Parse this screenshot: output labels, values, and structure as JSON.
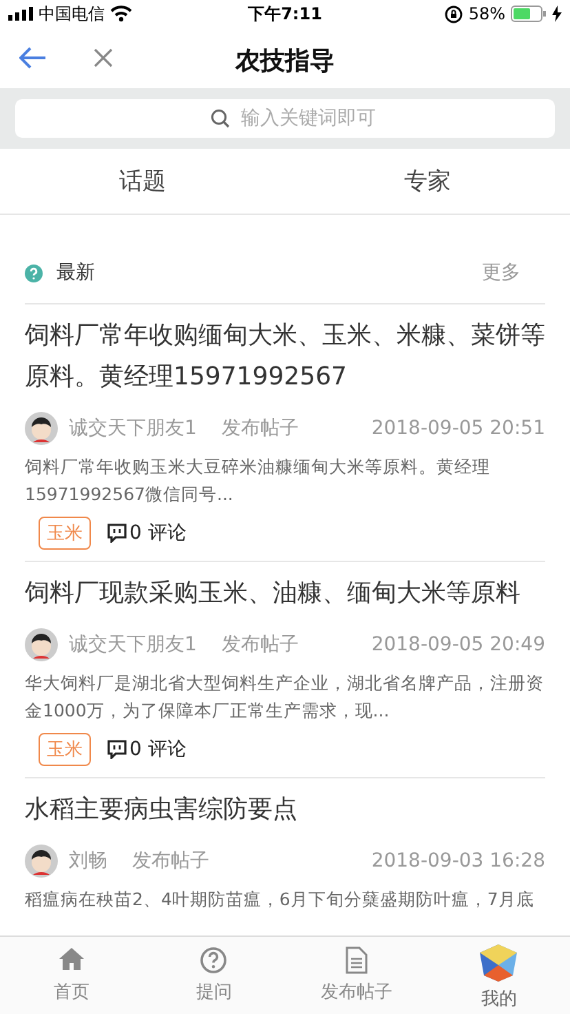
{
  "status_bar": {
    "carrier": "中国电信",
    "time": "下午7:11",
    "battery_text": "58%"
  },
  "nav": {
    "title": "农技指导"
  },
  "search": {
    "placeholder": "输入关键词即可"
  },
  "tabs": [
    {
      "label": "话题"
    },
    {
      "label": "专家"
    }
  ],
  "section": {
    "title": "最新",
    "more": "更多"
  },
  "posts": [
    {
      "title": "饲料厂常年收购缅甸大米、玉米、米糠、菜饼等原料。黄经理15971992567",
      "author": "诚交天下朋友1",
      "action": "发布帖子",
      "date": "2018-09-05 20:51",
      "excerpt": "饲料厂常年收购玉米大豆碎米油糠缅甸大米等原料。黄经理15971992567微信同号...",
      "tag": "玉米",
      "comments": "0 评论"
    },
    {
      "title": "饲料厂现款采购玉米、油糠、缅甸大米等原料",
      "author": "诚交天下朋友1",
      "action": "发布帖子",
      "date": "2018-09-05 20:49",
      "excerpt": "华大饲料厂是湖北省大型饲料生产企业，湖北省名牌产品，注册资金1000万，为了保障本厂正常生产需求，现...",
      "tag": "玉米",
      "comments": "0 评论"
    },
    {
      "title": "水稻主要病虫害综防要点",
      "author": "刘畅",
      "action": "发布帖子",
      "date": "2018-09-03 16:28",
      "excerpt": "稻瘟病在秧苗2、4叶期防苗瘟，6月下旬分蘖盛期防叶瘟，7月底"
    }
  ],
  "tab_bar": [
    {
      "kind": "home",
      "label": "首页"
    },
    {
      "kind": "question",
      "label": "提问"
    },
    {
      "kind": "document",
      "label": "发布帖子"
    },
    {
      "kind": "cube",
      "label": "我的"
    }
  ]
}
